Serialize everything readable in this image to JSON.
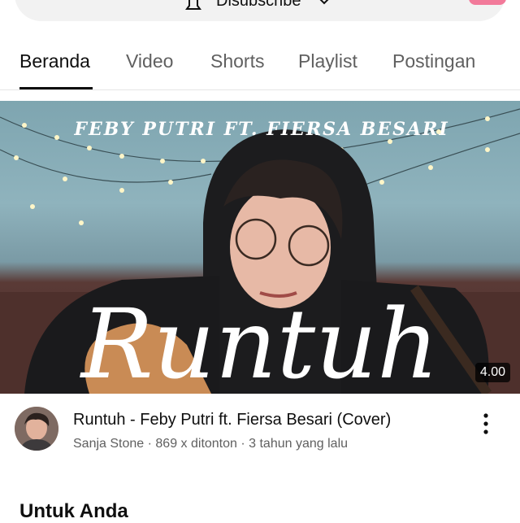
{
  "header": {
    "subscribe_label": "Disubscribe"
  },
  "tabs": [
    {
      "label": "Beranda",
      "active": true
    },
    {
      "label": "Video",
      "active": false
    },
    {
      "label": "Shorts",
      "active": false
    },
    {
      "label": "Playlist",
      "active": false
    },
    {
      "label": "Postingan",
      "active": false
    }
  ],
  "video": {
    "thumbnail_overlay_top": "FEBY PUTRI FT. FIERSA BESARI",
    "thumbnail_overlay_main": "Runtuh",
    "duration": "4.00",
    "title": "Runtuh - Feby Putri ft. Fiersa Besari (Cover)",
    "meta": "Sanja Stone · 869 x ditonton · 3 tahun yang lalu"
  },
  "section": {
    "title": "Untuk Anda"
  },
  "colors": {
    "accent_pink": "#f27a9a",
    "text_primary": "#0f0f0f",
    "text_secondary": "#606060"
  },
  "icons": [
    "bell-icon",
    "chevron-down-icon",
    "more-vert-icon"
  ]
}
